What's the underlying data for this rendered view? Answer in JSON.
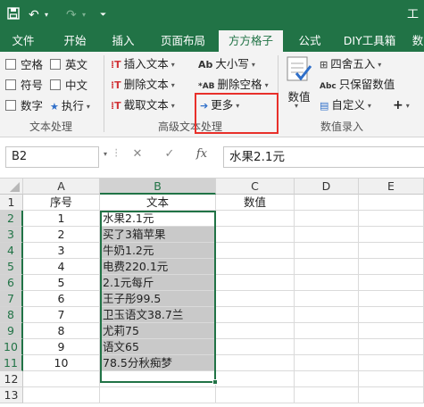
{
  "titlebar": {
    "save_icon": "save-icon",
    "undo_icon": "undo-icon",
    "redo_icon": "redo-icon",
    "customize_icon": "customize-quick-access-icon",
    "trailing_text": "工"
  },
  "tabs": [
    "文件",
    "开始",
    "插入",
    "页面布局",
    "方方格子",
    "公式",
    "DIY工具箱",
    "数"
  ],
  "active_tab": "方方格子",
  "ribbon": {
    "text_processing": {
      "label": "文本处理",
      "checkboxes": [
        "空格",
        "英文",
        "符号",
        "中文",
        "数字"
      ],
      "execute": "执行"
    },
    "advanced_text": {
      "label": "高级文本处理",
      "insert_text": "插入文本",
      "delete_text": "删除文本",
      "extract_text": "截取文本",
      "case": "大小写",
      "delete_spaces": "删除空格",
      "more": "更多"
    },
    "numeric_input": {
      "label": "数值录入",
      "numeric": "数值",
      "round": "四舍五入",
      "keep_numeric": "只保留数值",
      "custom": "自定义"
    }
  },
  "formula_bar": {
    "name_box": "B2",
    "cancel": "✕",
    "confirm": "✓",
    "fx": "fx",
    "value": "水果2.1元"
  },
  "sheet": {
    "columns": [
      "A",
      "B",
      "C",
      "D",
      "E"
    ],
    "rows": [
      "1",
      "2",
      "3",
      "4",
      "5",
      "6",
      "7",
      "8",
      "9",
      "10",
      "11",
      "12",
      "13"
    ],
    "header": {
      "a": "序号",
      "b": "文本",
      "c": "数值"
    },
    "data": [
      {
        "a": "1",
        "b": "水果2.1元"
      },
      {
        "a": "2",
        "b": "买了3箱苹果"
      },
      {
        "a": "3",
        "b": "牛奶1.2元"
      },
      {
        "a": "4",
        "b": "电费220.1元"
      },
      {
        "a": "5",
        "b": "2.1元每斤"
      },
      {
        "a": "6",
        "b": "王子彤99.5"
      },
      {
        "a": "7",
        "b": "卫玉语文38.7兰"
      },
      {
        "a": "8",
        "b": "尤莉75"
      },
      {
        "a": "9",
        "b": "语文65"
      },
      {
        "a": "10",
        "b": "78.5分秋痴梦"
      }
    ]
  }
}
